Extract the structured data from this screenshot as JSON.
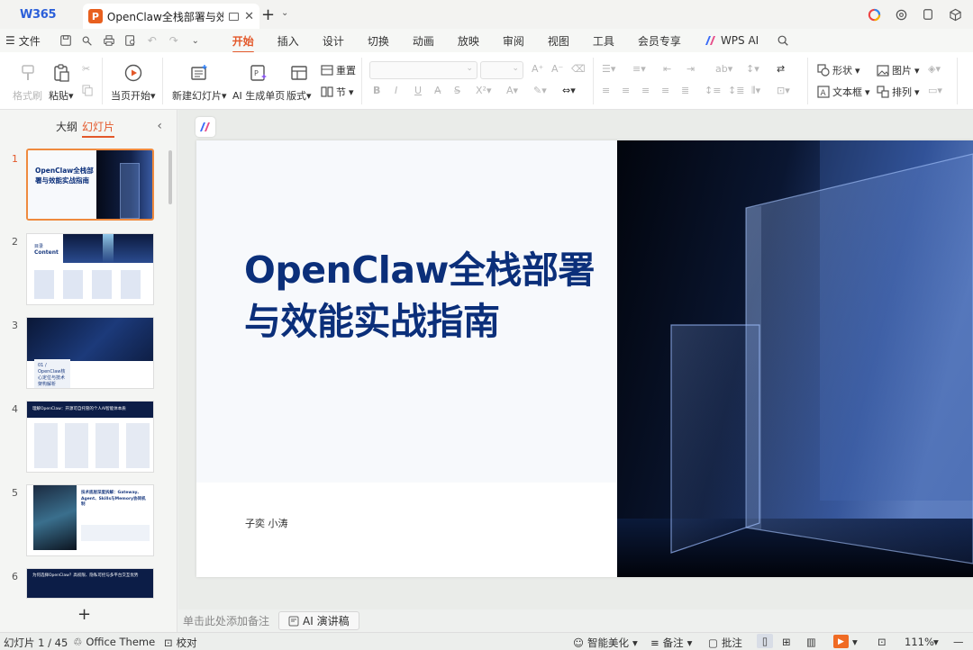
{
  "app": {
    "logo": "W365"
  },
  "doc_tab": {
    "badge": "P",
    "title": "OpenClaw全栈部署与效能实战指南"
  },
  "menubar": {
    "file": "文件",
    "items": [
      "开始",
      "插入",
      "设计",
      "切换",
      "动画",
      "放映",
      "审阅",
      "视图",
      "工具",
      "会员专享"
    ],
    "active": "开始",
    "wps_ai": "WPS AI"
  },
  "ribbon": {
    "format_painter": "格式刷",
    "paste": "粘贴",
    "play_current": "当页开始",
    "new_slide": "新建幻灯片",
    "ai_generate": "AI 生成单页",
    "layout": "版式",
    "reset": "重置",
    "section": "节",
    "shape": "形状",
    "picture": "图片",
    "textbox": "文本框",
    "arrange": "排列"
  },
  "left_panel": {
    "tab_outline": "大纲",
    "tab_slides": "幻灯片",
    "thumbnails": [
      {
        "num": "1",
        "title": "OpenClaw全栈部署与效能实战指南"
      },
      {
        "num": "2",
        "title": "目录",
        "subtitle": "Content"
      },
      {
        "num": "3",
        "title": "01 / OpenClaw核心定位与技术架构解析"
      },
      {
        "num": "4",
        "title": "理解OpenClaw：开源可自托管的个人AI智能体本质"
      },
      {
        "num": "5",
        "title": "技术底层深度拆解：Gateway、Agent、Skills与Memory协同机制"
      },
      {
        "num": "6",
        "title": "为何选择OpenClaw？高权限、隐私可控与多平台交互优势"
      }
    ]
  },
  "slide": {
    "title": "OpenClaw全栈部署与效能实战指南",
    "authors": "子奕 小涛"
  },
  "notes": {
    "placeholder": "单击此处添加备注",
    "ai_script": "AI 演讲稿"
  },
  "status": {
    "slide_counter": "幻灯片 1 / 45",
    "theme": "Office Theme",
    "proofread": "校对",
    "beautify": "智能美化",
    "notes": "备注",
    "comments": "批注",
    "zoom": "111%"
  }
}
